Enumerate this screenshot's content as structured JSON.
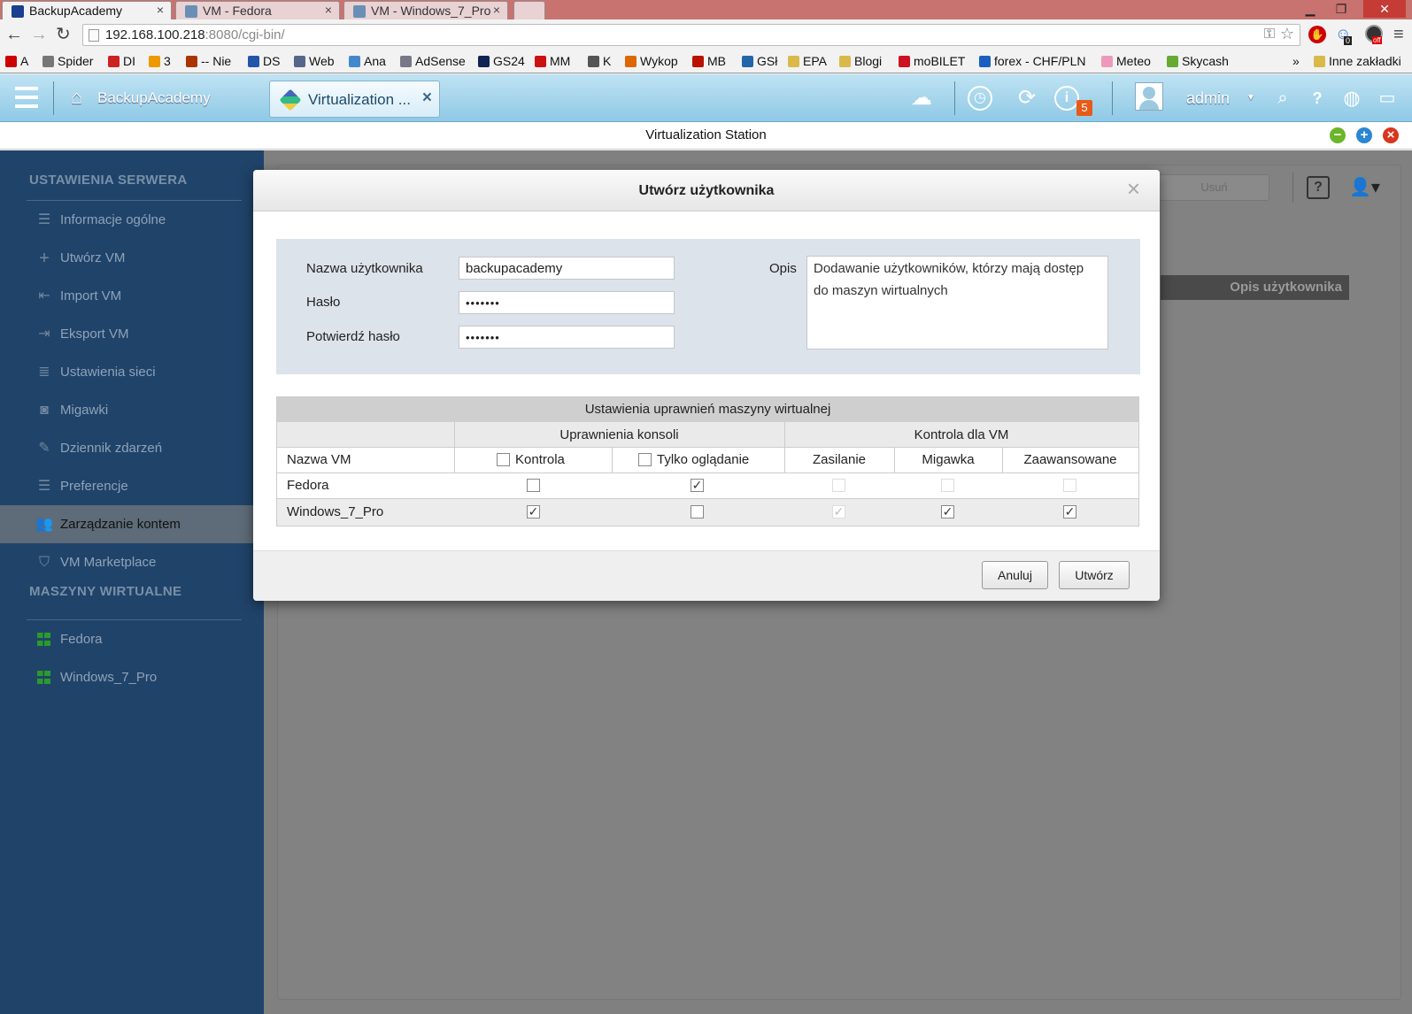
{
  "browser": {
    "tabs": [
      {
        "title": "BackupAcademy",
        "active": true,
        "close": "×"
      },
      {
        "title": "VM - Fedora",
        "active": false,
        "close": "×"
      },
      {
        "title": "VM - Windows_7_Pro",
        "active": false,
        "close": "×"
      }
    ],
    "url_host": "192.168.100.218",
    "url_rest": ":8080/cgi-bin/",
    "bookmarks": [
      {
        "label": "A",
        "color": "#c00"
      },
      {
        "label": "Spider",
        "color": "#777"
      },
      {
        "label": "DI",
        "color": "#c22"
      },
      {
        "label": "3",
        "color": "#e90"
      },
      {
        "label": "-- Nie",
        "color": "#a30"
      },
      {
        "label": "DS",
        "color": "#25a"
      },
      {
        "label": "Web",
        "color": "#568"
      },
      {
        "label": "Ana",
        "color": "#48c"
      },
      {
        "label": "AdSense",
        "color": "#778"
      },
      {
        "label": "GS24",
        "color": "#125"
      },
      {
        "label": "MM",
        "color": "#c11"
      },
      {
        "label": "K",
        "color": "#555"
      },
      {
        "label": "Wykop",
        "color": "#d60"
      },
      {
        "label": "MB",
        "color": "#b10"
      },
      {
        "label": "GSł",
        "color": "#26a"
      },
      {
        "label": "EPA",
        "color": "#d9b94a"
      },
      {
        "label": "Blogi",
        "color": "#d9b94a"
      },
      {
        "label": "moBILET",
        "color": "#c12"
      },
      {
        "label": "forex - CHF/PLN",
        "color": "#1a5fbf"
      },
      {
        "label": "Meteo",
        "color": "#e9b"
      },
      {
        "label": "Skycash",
        "color": "#6a3"
      }
    ],
    "bookmarks_overflow": "»",
    "other_bookmarks": "Inne zakładki",
    "ext_badges": {
      "badge1": "0",
      "badge2": "off"
    }
  },
  "header": {
    "home_label": "BackupAcademy",
    "app_tab_label": "Virtualization ...",
    "app_tab_close": "×",
    "notifications_count": "5",
    "user": "admin",
    "user_caret": "▼"
  },
  "app_title": "Virtualization Station",
  "sidebar": {
    "server_section": "USTAWIENIA SERWERA",
    "items": [
      {
        "label": "Informacje ogólne"
      },
      {
        "label": "Utwórz VM"
      },
      {
        "label": "Import VM"
      },
      {
        "label": "Eksport VM"
      },
      {
        "label": "Ustawienia sieci"
      },
      {
        "label": "Migawki"
      },
      {
        "label": "Dziennik zdarzeń"
      },
      {
        "label": "Preferencje"
      },
      {
        "label": "Zarządzanie kontem",
        "selected": true
      },
      {
        "label": "VM Marketplace"
      }
    ],
    "vm_section": "MASZYNY WIRTUALNE",
    "vms": [
      {
        "label": "Fedora"
      },
      {
        "label": "Windows_7_Pro"
      }
    ]
  },
  "background": {
    "delete_button": "Usuń",
    "help_button": "?",
    "column_header": "Opis użytkownika"
  },
  "dialog": {
    "title": "Utwórz użytkownika",
    "close": "×",
    "username_label": "Nazwa użytkownika",
    "username_value": "backupacademy",
    "password_label": "Hasło",
    "password_value": "•••••••",
    "confirm_label": "Potwierdź hasło",
    "confirm_value": "•••••••",
    "description_label": "Opis",
    "description_value": "Dodawanie użytkowników, którzy mają dostęp do maszyn wirtualnych",
    "table": {
      "title": "Ustawienia uprawnień maszyny wirtualnej",
      "group_console": "Uprawnienia konsoli",
      "group_control": "Kontrola dla VM",
      "col_name": "Nazwa VM",
      "col_control": "Kontrola",
      "col_view": "Tylko oglądanie",
      "col_power": "Zasilanie",
      "col_snapshot": "Migawka",
      "col_advanced": "Zaawansowane",
      "rows": [
        {
          "name": "Fedora",
          "control": false,
          "view": true,
          "power": false,
          "snapshot": false,
          "advanced": false,
          "power_disabled": true,
          "snapshot_disabled": true,
          "advanced_disabled": true
        },
        {
          "name": "Windows_7_Pro",
          "control": true,
          "view": false,
          "power": true,
          "snapshot": true,
          "advanced": true,
          "power_disabled": true,
          "snapshot_disabled": false,
          "advanced_disabled": false
        }
      ]
    },
    "cancel_button": "Anuluj",
    "create_button": "Utwórz"
  },
  "colors": {
    "sidebar": "#20436a",
    "header": "#8fc9e6",
    "overlay": "#808080"
  }
}
